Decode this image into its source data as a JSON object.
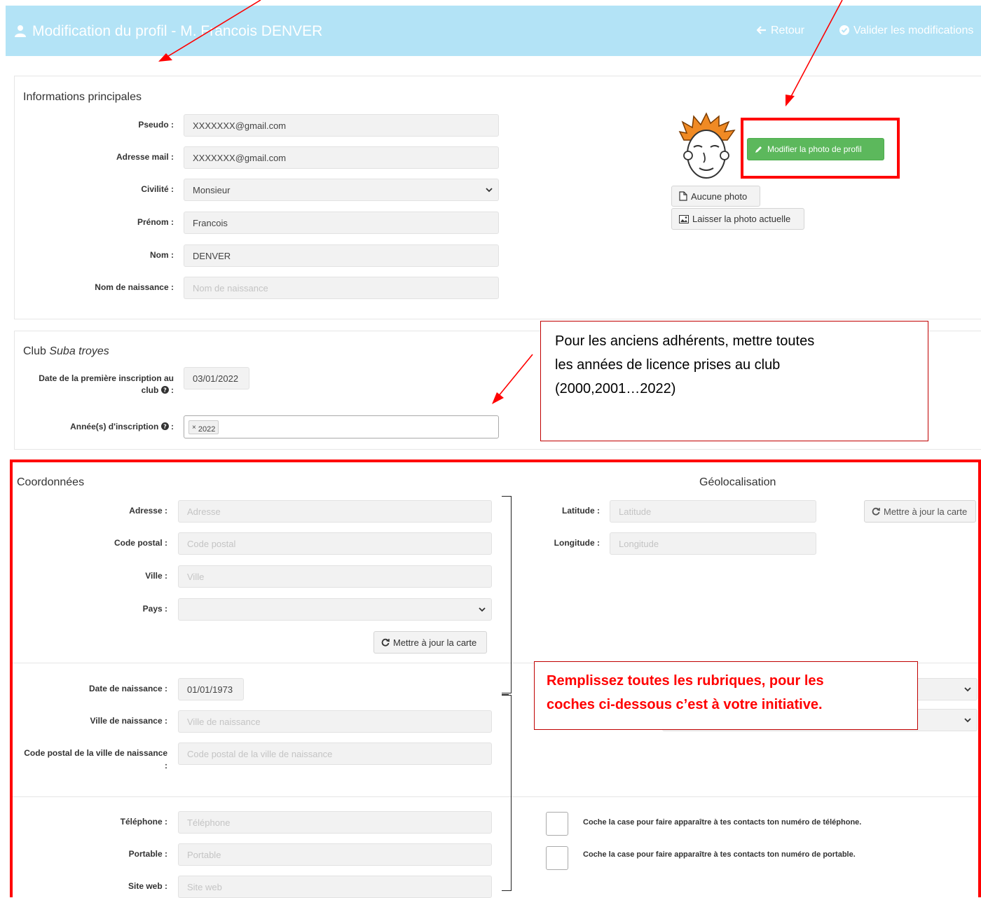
{
  "header": {
    "title": "Modification du profil - M. Francois DENVER",
    "back_label": "Retour",
    "validate_label": "Valider les modifications"
  },
  "main_info": {
    "section_title": "Informations principales",
    "pseudo": {
      "label": "Pseudo :",
      "value": "XXXXXXX@gmail.com"
    },
    "email": {
      "label": "Adresse mail :",
      "value": "XXXXXXX@gmail.com"
    },
    "civility": {
      "label": "Civilité :",
      "value": "Monsieur"
    },
    "first_name": {
      "label": "Prénom :",
      "value": "Francois"
    },
    "last_name": {
      "label": "Nom :",
      "value": "DENVER"
    },
    "birth_name": {
      "label": "Nom de naissance :",
      "placeholder": "Nom de naissance"
    },
    "photo": {
      "modify_label": "Modifier la photo de profil",
      "no_photo_label": "Aucune photo",
      "keep_photo_label": "Laisser la photo actuelle"
    }
  },
  "club": {
    "title_prefix": "Club",
    "club_name": "Suba troyes",
    "first_inscription_label_line1": "Date de la première inscription au",
    "first_inscription_label_line2": "club",
    "first_inscription_value": "03/01/2022",
    "years_label": "Année(s) d'inscription",
    "years": [
      "2022"
    ],
    "tag_remove": "×"
  },
  "coords": {
    "section_title": "Coordonnées",
    "address": {
      "label": "Adresse :",
      "placeholder": "Adresse"
    },
    "postal_code": {
      "label": "Code postal :",
      "placeholder": "Code postal"
    },
    "city": {
      "label": "Ville :",
      "placeholder": "Ville"
    },
    "country": {
      "label": "Pays :",
      "value": ""
    },
    "update_map_label": "Mettre à jour la carte",
    "birth_date": {
      "label": "Date de naissance :",
      "value": "01/01/1973"
    },
    "birth_city": {
      "label": "Ville de naissance :",
      "placeholder": "Ville de naissance"
    },
    "birth_postal_label_line1": "Code postal de la ville de naissance",
    "birth_postal_label_line2": ":",
    "birth_postal_placeholder": "Code postal de la ville de naissance",
    "phone": {
      "label": "Téléphone :",
      "placeholder": "Téléphone"
    },
    "mobile": {
      "label": "Portable :",
      "placeholder": "Portable"
    },
    "website": {
      "label": "Site web :",
      "placeholder": "Site web"
    }
  },
  "geo": {
    "section_title": "Géolocalisation",
    "latitude": {
      "label": "Latitude :",
      "placeholder": "Latitude"
    },
    "longitude": {
      "label": "Longitude :",
      "placeholder": "Longitude"
    },
    "update_map_label": "Mettre à jour la carte",
    "show_phone_label": "Coche la case pour faire apparaître à tes contacts ton numéro de téléphone.",
    "show_mobile_label": "Coche la case pour faire apparaître à tes contacts ton numéro de portable."
  },
  "annotations": {
    "callout1_lines": [
      "Pour les anciens adhérents, mettre toutes",
      "les années de licence prises au club",
      "(2000,2001…2022)"
    ],
    "callout2_lines": [
      "Remplissez toutes les rubriques, pour les",
      "coches ci-dessous c’est à votre initiative."
    ]
  },
  "colors": {
    "header_bg": "#b3e3f6",
    "green_button": "#5cb85c",
    "annotation_red": "#ff0000"
  }
}
